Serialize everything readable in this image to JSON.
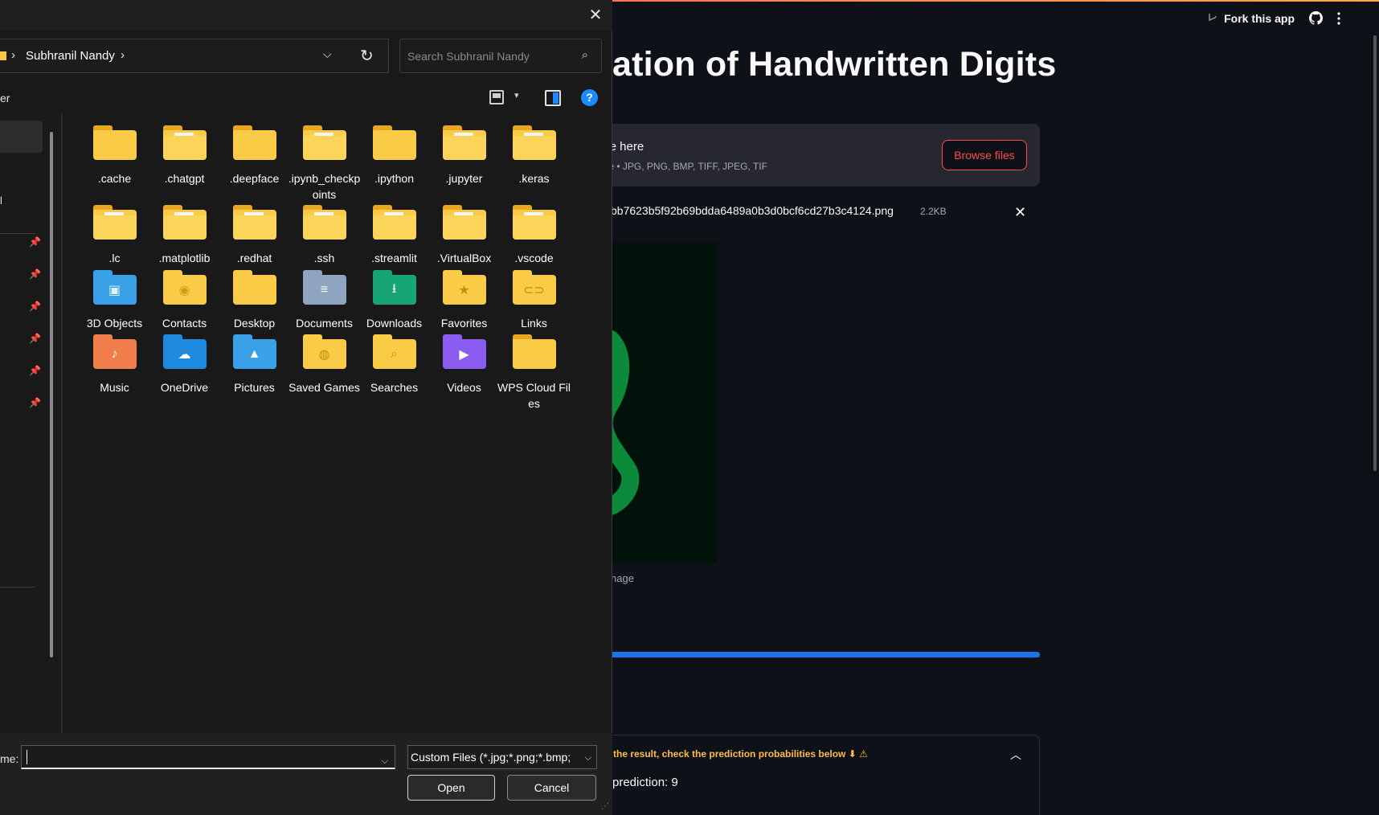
{
  "app": {
    "header": {
      "fork_label": "Fork this app"
    },
    "title": "ation of Handwritten Digits",
    "uploader": {
      "drag_text": "ile here",
      "limits_text": "ile • JPG, PNG, BMP, TIFF, JPEG, TIF",
      "browse_label": "Browse files"
    },
    "uploaded_file": {
      "name": "bb7623b5f92b69bdda6489a0b3d0bcf6cd27b3c4124.png",
      "size": "2.2KB"
    },
    "image_caption": "nage",
    "progress_percent": 100,
    "expander": {
      "title": "the result, check the prediction probabilities below ⬇ ⚠",
      "prediction_text": "prediction: 9"
    },
    "colors": {
      "accent": "#ff4b4b",
      "progress": "#1a73e8",
      "warning": "#ffbd45",
      "background": "#0e1117"
    }
  },
  "dialog": {
    "address": {
      "crumb": "Subhranil Nandy"
    },
    "search": {
      "placeholder": "Search Subhranil Nandy"
    },
    "command_bar": {
      "partial_label": "er"
    },
    "nav": {
      "partial_label": "l"
    },
    "items": [
      {
        "label": ".cache",
        "icon": "folder-icon"
      },
      {
        "label": ".chatgpt",
        "icon": "folder-icon"
      },
      {
        "label": ".deepface",
        "icon": "folder-icon"
      },
      {
        "label": ".ipynb_checkpoints",
        "icon": "folder-icon"
      },
      {
        "label": ".ipython",
        "icon": "folder-icon"
      },
      {
        "label": ".jupyter",
        "icon": "folder-icon"
      },
      {
        "label": ".keras",
        "icon": "folder-icon"
      },
      {
        "label": ".lc",
        "icon": "folder-icon"
      },
      {
        "label": ".matplotlib",
        "icon": "folder-icon"
      },
      {
        "label": ".redhat",
        "icon": "folder-icon"
      },
      {
        "label": ".ssh",
        "icon": "folder-icon"
      },
      {
        "label": ".streamlit",
        "icon": "folder-icon"
      },
      {
        "label": ".VirtualBox",
        "icon": "folder-icon"
      },
      {
        "label": ".vscode",
        "icon": "folder-icon"
      },
      {
        "label": "3D Objects",
        "icon": "3d-objects-icon"
      },
      {
        "label": "Contacts",
        "icon": "contacts-icon"
      },
      {
        "label": "Desktop",
        "icon": "desktop-folder-icon"
      },
      {
        "label": "Documents",
        "icon": "documents-icon"
      },
      {
        "label": "Downloads",
        "icon": "downloads-icon"
      },
      {
        "label": "Favorites",
        "icon": "favorites-icon"
      },
      {
        "label": "Links",
        "icon": "links-icon"
      },
      {
        "label": "Music",
        "icon": "music-icon"
      },
      {
        "label": "OneDrive",
        "icon": "onedrive-icon"
      },
      {
        "label": "Pictures",
        "icon": "pictures-icon"
      },
      {
        "label": "Saved Games",
        "icon": "saved-games-icon"
      },
      {
        "label": "Searches",
        "icon": "searches-icon"
      },
      {
        "label": "Videos",
        "icon": "videos-icon"
      },
      {
        "label": "WPS Cloud Files",
        "icon": "folder-icon"
      }
    ],
    "bottom": {
      "filename_label": "me:",
      "filename_value": "",
      "filetype_selected": "Custom Files (*.jpg;*.png;*.bmp;",
      "open_label": "Open",
      "cancel_label": "Cancel"
    }
  }
}
